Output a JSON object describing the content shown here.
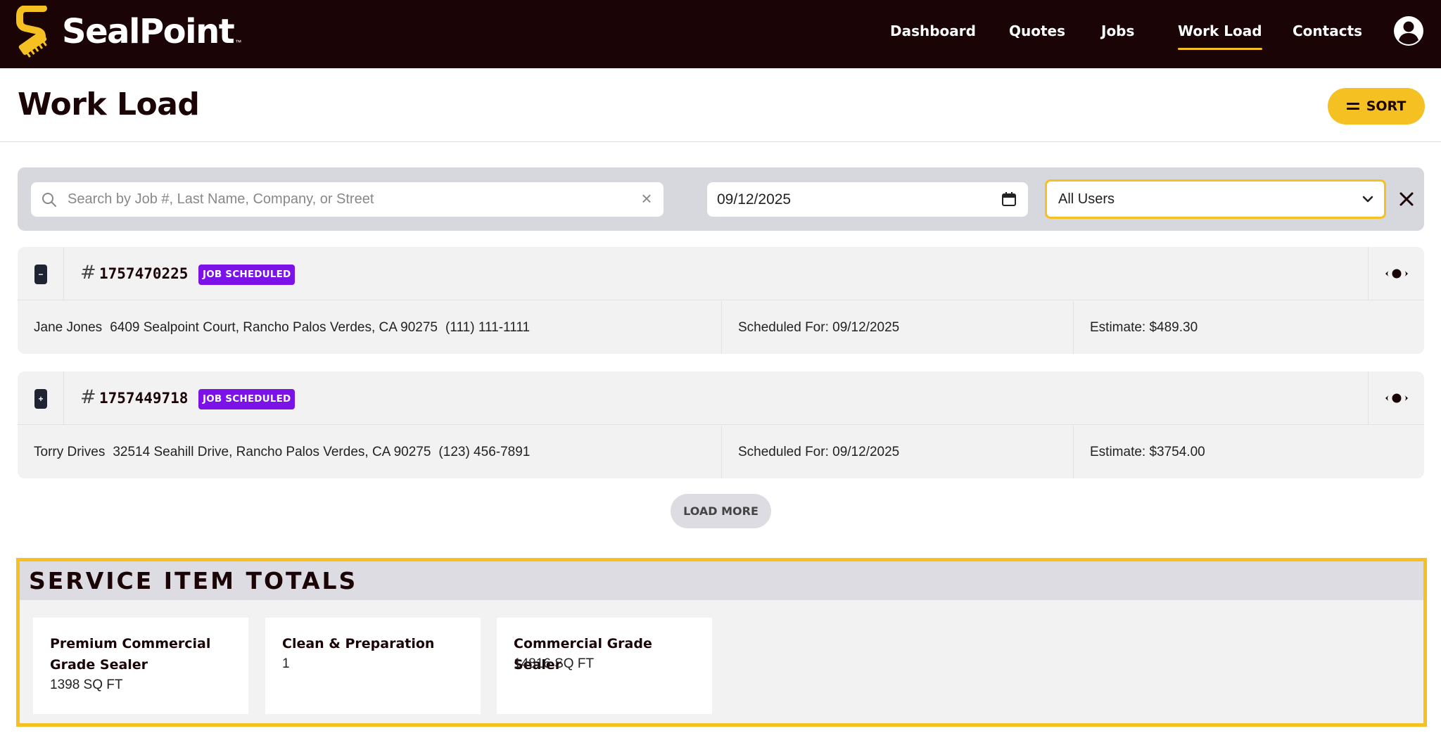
{
  "app": {
    "brand": "SealPoint",
    "brand_tm": "™"
  },
  "nav": {
    "items": [
      {
        "label": "Dashboard"
      },
      {
        "label": "Quotes"
      },
      {
        "label": "Jobs"
      },
      {
        "label": "Work Load",
        "active": true
      },
      {
        "label": "Contacts"
      }
    ]
  },
  "page": {
    "title": "Work Load",
    "sort_label": "SORT"
  },
  "filters": {
    "search_placeholder": "Search by Job #, Last Name, Company, or Street",
    "search_value": "",
    "date_value": "09/12/2025",
    "user_selected": "All Users"
  },
  "jobs": [
    {
      "number": "1757470225",
      "status": "JOB SCHEDULED",
      "name": "Jane Jones",
      "address": "6409 Sealpoint Court, Rancho Palos Verdes, CA 90275",
      "phone": "(111) 111-1111",
      "scheduled": "Scheduled For: 09/12/2025",
      "estimate": "Estimate: $489.30"
    },
    {
      "number": "1757449718",
      "status": "JOB SCHEDULED",
      "name": "Torry Drives",
      "address": "32514 Seahill Drive, Rancho Palos Verdes, CA 90275",
      "phone": "(123) 456-7891",
      "scheduled": "Scheduled For: 09/12/2025",
      "estimate": "Estimate: $3754.00"
    }
  ],
  "load_more_label": "LOAD MORE",
  "totals": {
    "title": "SERVICE ITEM TOTALS",
    "items": [
      {
        "name": "Premium Commercial Grade Sealer",
        "qty": "1398 SQ FT"
      },
      {
        "name": "Clean & Preparation",
        "qty": "1"
      },
      {
        "name": "Commercial Grade Sealer",
        "qty": "14816 SQ FT"
      }
    ]
  },
  "colors": {
    "header_bg": "#1b0406",
    "accent": "#f5c021",
    "badge": "#7b12e8"
  },
  "icons": [
    "sealpoint-logo-icon",
    "user-avatar-icon",
    "menu-lines-icon",
    "search-icon",
    "clear-icon",
    "calendar-icon",
    "chevron-down-icon",
    "close-icon",
    "collapse-icon",
    "eye-icon"
  ]
}
